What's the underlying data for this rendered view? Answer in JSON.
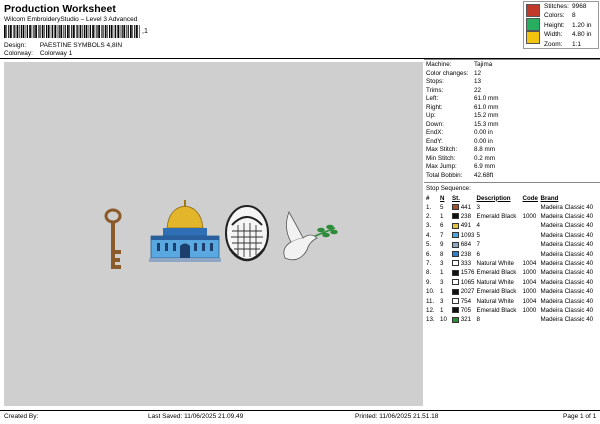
{
  "header": {
    "title": "Production Worksheet",
    "subtitle": "Wilcom EmbroideryStudio – Level 3 Advanced",
    "barcode_suffix": ",1",
    "design_label": "Design:",
    "design_value": "PAESTINE SYMBOLS 4,8IN",
    "colorway_label": "Colorway:",
    "colorway_value": "Colorway 1"
  },
  "stats": {
    "stitches_label": "Stitches:",
    "stitches_value": "9968",
    "colors_label": "Colors:",
    "colors_value": "8",
    "height_label": "Height:",
    "height_value": "1.20 in",
    "width_label": "Width:",
    "width_value": "4.80 in",
    "zoom_label": "Zoom:",
    "zoom_value": "1:1",
    "swatch_colors": [
      "#c0392b",
      "#27ae60",
      "#f1c40f"
    ]
  },
  "machine": {
    "machine_label": "Machine:",
    "machine_value": "Tajima",
    "color_changes_label": "Color changes:",
    "color_changes_value": "12",
    "stops_label": "Stops:",
    "stops_value": "13",
    "trims_label": "Trims:",
    "trims_value": "22",
    "left_label": "Left:",
    "left_value": "61.0 mm",
    "right_label": "Right:",
    "right_value": "61.0 mm",
    "up_label": "Up:",
    "up_value": "15.2 mm",
    "down_label": "Down:",
    "down_value": "15.3 mm",
    "endx_label": "EndX:",
    "endx_value": "0.00 in",
    "endy_label": "EndY:",
    "endy_value": "0.00 in",
    "max_stitch_label": "Max Stitch:",
    "max_stitch_value": "8.8 mm",
    "min_stitch_label": "Min Stitch:",
    "min_stitch_value": "0.2 mm",
    "max_jump_label": "Max Jump:",
    "max_jump_value": "6.9 mm",
    "total_bobbin_label": "Total Bobbin:",
    "total_bobbin_value": "42.68ft"
  },
  "stop_sequence": {
    "title": "Stop Sequence:",
    "headers": [
      "#",
      "N",
      "St.",
      "Description",
      "Code",
      "Brand"
    ],
    "rows": [
      {
        "n": "1.",
        "num": "5",
        "swatch": "#a0522d",
        "st": "441",
        "desc": "3",
        "code": "",
        "brand": "Madeira Classic 40"
      },
      {
        "n": "2.",
        "num": "1",
        "swatch": "#111111",
        "st": "238",
        "desc": "Emerald Black",
        "code": "1000",
        "brand": "Madeira Classic 40"
      },
      {
        "n": "3.",
        "num": "6",
        "swatch": "#e0c040",
        "st": "491",
        "desc": "4",
        "code": "",
        "brand": "Madeira Classic 40"
      },
      {
        "n": "4.",
        "num": "7",
        "swatch": "#4aa8e0",
        "st": "1093",
        "desc": "5",
        "code": "",
        "brand": "Madeira Classic 40"
      },
      {
        "n": "5.",
        "num": "9",
        "swatch": "#8fa6c4",
        "st": "684",
        "desc": "7",
        "code": "",
        "brand": "Madeira Classic 40"
      },
      {
        "n": "6.",
        "num": "8",
        "swatch": "#2f7fd0",
        "st": "238",
        "desc": "6",
        "code": "",
        "brand": "Madeira Classic 40"
      },
      {
        "n": "7.",
        "num": "3",
        "swatch": "#ffffff",
        "st": "333",
        "desc": "Natural White",
        "code": "1004",
        "brand": "Madeira Classic 40"
      },
      {
        "n": "8.",
        "num": "1",
        "swatch": "#111111",
        "st": "1576",
        "desc": "Emerald Black",
        "code": "1000",
        "brand": "Madeira Classic 40"
      },
      {
        "n": "9.",
        "num": "3",
        "swatch": "#ffffff",
        "st": "1065",
        "desc": "Natural White",
        "code": "1004",
        "brand": "Madeira Classic 40"
      },
      {
        "n": "10.",
        "num": "1",
        "swatch": "#111111",
        "st": "2027",
        "desc": "Emerald Black",
        "code": "1000",
        "brand": "Madeira Classic 40"
      },
      {
        "n": "11.",
        "num": "3",
        "swatch": "#ffffff",
        "st": "754",
        "desc": "Natural White",
        "code": "1004",
        "brand": "Madeira Classic 40"
      },
      {
        "n": "12.",
        "num": "1",
        "swatch": "#111111",
        "st": "705",
        "desc": "Emerald Black",
        "code": "1000",
        "brand": "Madeira Classic 40"
      },
      {
        "n": "13.",
        "num": "10",
        "swatch": "#2e8b3a",
        "st": "321",
        "desc": "8",
        "code": "",
        "brand": "Madeira Classic 40"
      }
    ]
  },
  "footer": {
    "created_by": "Created By:",
    "last_saved": "Last Saved: 11/06/2025 21.09.49",
    "printed": "Printed: 11/06/2025 21.51.18",
    "page": "Page 1 of 1"
  },
  "icons": [
    "key-icon",
    "dome-of-the-rock-icon",
    "keffiyeh-icon",
    "dove-icon"
  ]
}
